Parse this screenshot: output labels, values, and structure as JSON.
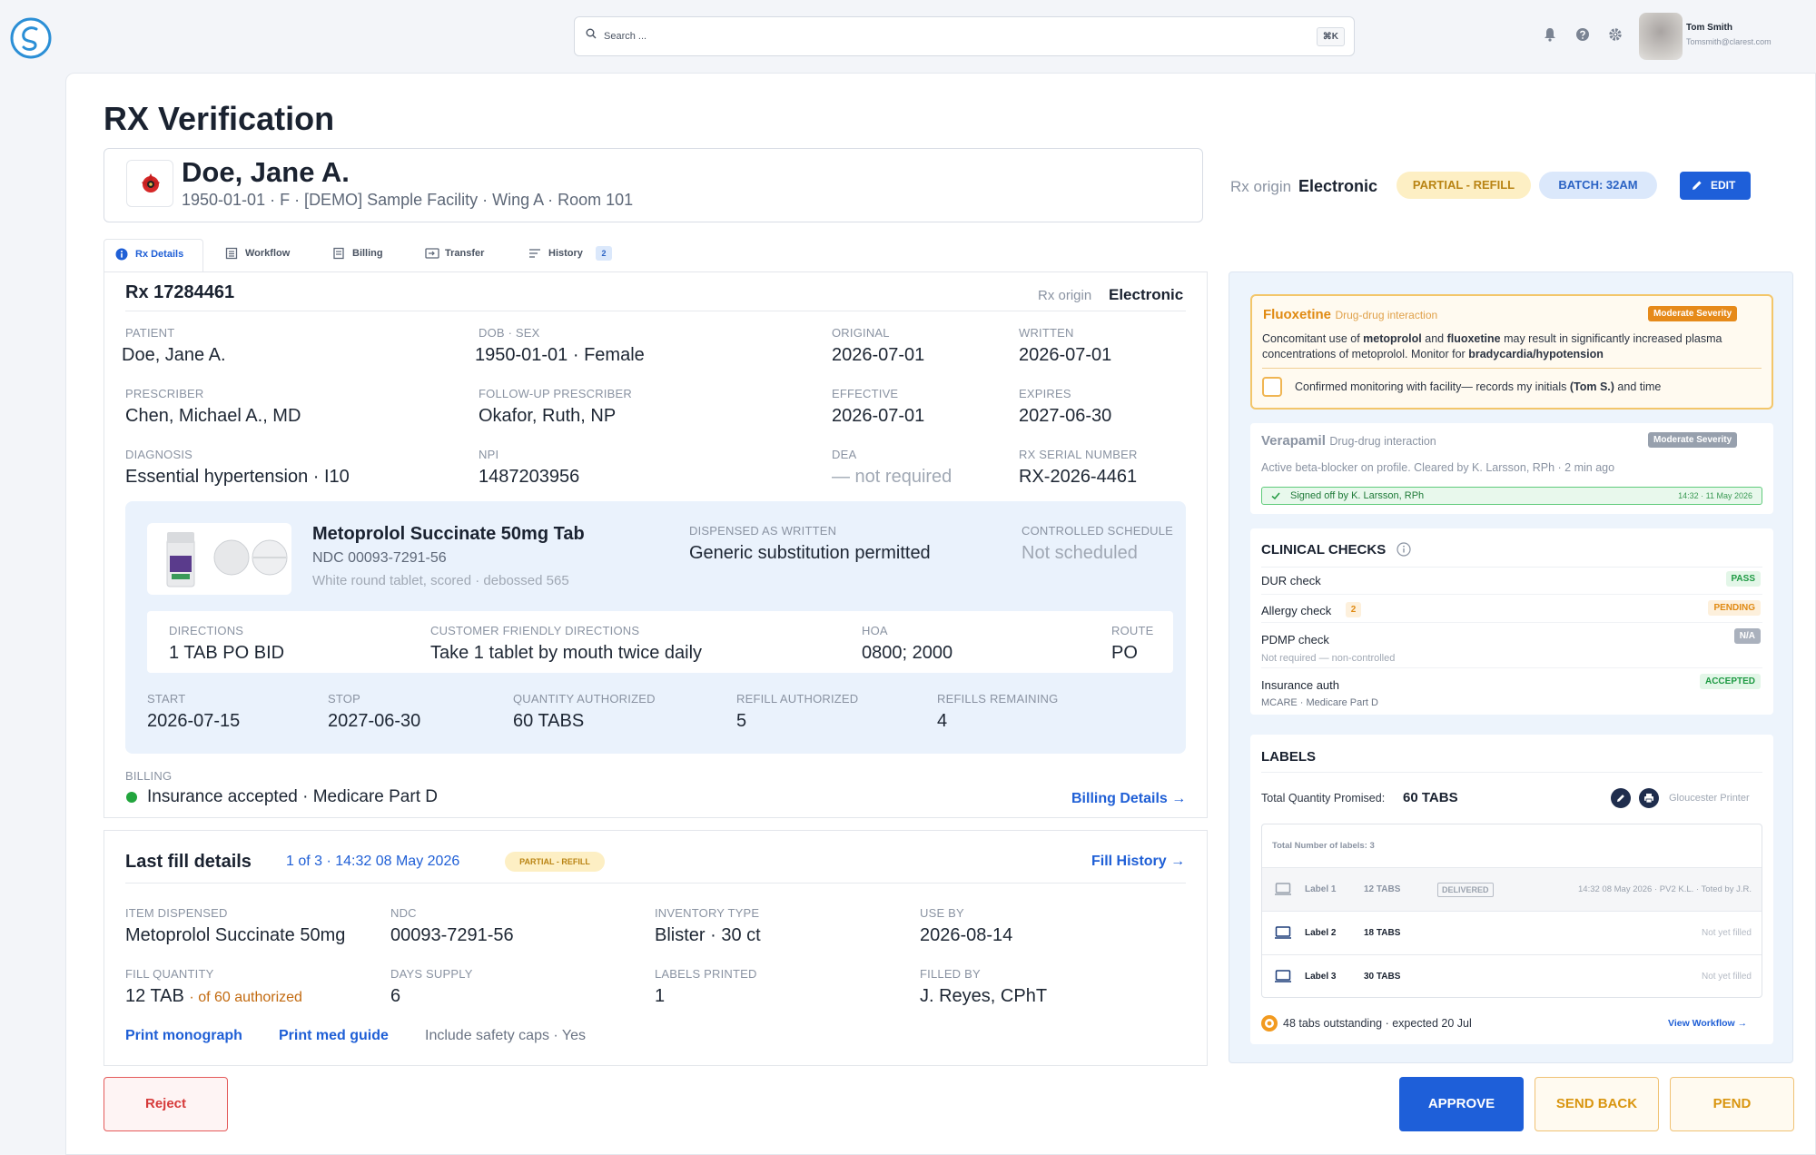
{
  "topbar": {
    "search_placeholder": "Search ...",
    "search_shortcut": "⌘K",
    "user_name": "Tom Smith",
    "user_email": "Tomsmith@clarest.com"
  },
  "page_title": "RX Verification",
  "patient": {
    "name": "Doe, Jane A.",
    "info": "1950-01-01 · F · [DEMO] Sample Facility · Wing A · Room 101",
    "rx_origin_label": "Rx origin",
    "rx_origin_value": "Electronic",
    "status_pill": "PARTIAL - REFILL",
    "batch_pill": "BATCH: 32AM",
    "edit_label": "EDIT"
  },
  "tabs": [
    {
      "label": "Rx Details",
      "icon": "info-icon"
    },
    {
      "label": "Workflow",
      "icon": "workflow-icon"
    },
    {
      "label": "Billing",
      "icon": "billing-icon"
    },
    {
      "label": "Transfer",
      "icon": "transfer-icon"
    },
    {
      "label": "History",
      "icon": "history-icon",
      "badge": "2"
    }
  ],
  "rx": {
    "number": "Rx 17284461",
    "origin_label": "Rx origin",
    "origin_value": "Electronic",
    "fields": [
      {
        "label": "PATIENT",
        "value": "Doe, Jane A."
      },
      {
        "label": "DOB · SEX",
        "value": "1950-01-01 · Female"
      },
      {
        "label": "ORIGINAL",
        "value": "2026-07-01"
      },
      {
        "label": "WRITTEN",
        "value": "2026-07-01"
      },
      {
        "label": "PRESCRIBER",
        "value": "Chen, Michael A., MD"
      },
      {
        "label": "FOLLOW-UP PRESCRIBER",
        "value": "Okafor, Ruth, NP"
      },
      {
        "label": "EFFECTIVE",
        "value": "2026-07-01"
      },
      {
        "label": "EXPIRES",
        "value": "2027-06-30"
      },
      {
        "label": "DIAGNOSIS",
        "value": "Essential hypertension · I10"
      },
      {
        "label": "NPI",
        "value": "1487203956"
      },
      {
        "label": "DEA",
        "value": "— not required"
      },
      {
        "label": "RX SERIAL NUMBER",
        "value": "RX-2026-4461"
      }
    ],
    "drug": {
      "name": "Metoprolol Succinate 50mg Tab",
      "ndc": "NDC 00093-7291-56",
      "description": "White round tablet, scored · debossed 565",
      "daw_label": "DISPENSED AS WRITTEN",
      "daw_value": "Generic substitution permitted",
      "schedule_label": "CONTROLLED SCHEDULE",
      "schedule_value": "Not scheduled"
    },
    "directions": [
      {
        "label": "DIRECTIONS",
        "value": "1 TAB PO BID"
      },
      {
        "label": "CUSTOMER FRIENDLY DIRECTIONS",
        "value": "Take 1 tablet by mouth twice daily"
      },
      {
        "label": "HOA",
        "value": "0800; 2000"
      },
      {
        "label": "ROUTE",
        "value": "PO"
      }
    ],
    "quantities": [
      {
        "label": "START",
        "value": "2026-07-15"
      },
      {
        "label": "STOP",
        "value": "2027-06-30"
      },
      {
        "label": "QUANTITY AUTHORIZED",
        "value": "60 TABS"
      },
      {
        "label": "REFILL AUTHORIZED",
        "value": "5"
      },
      {
        "label": "REFILLS REMAINING",
        "value": "4"
      }
    ],
    "billing_label": "BILLING",
    "billing_value": "Insurance accepted · Medicare Part D",
    "billing_link": "Billing Details →"
  },
  "last_fill": {
    "title": "Last fill details",
    "meta": "1 of 3 · 14:32  08 May 2026",
    "pill": "PARTIAL - REFILL",
    "history_link": "Fill History →",
    "fields": [
      {
        "label": "ITEM DISPENSED",
        "value": "Metoprolol Succinate 50mg"
      },
      {
        "label": "NDC",
        "value": "00093-7291-56"
      },
      {
        "label": "INVENTORY TYPE",
        "value": "Blister · 30 ct"
      },
      {
        "label": "USE BY",
        "value": "2026-08-14"
      },
      {
        "label": "FILL QUANTITY",
        "value": "12 TAB",
        "note": "· of 60 authorized"
      },
      {
        "label": "DAYS SUPPLY",
        "value": "6"
      },
      {
        "label": "LABELS PRINTED",
        "value": "1"
      },
      {
        "label": "FILLED BY",
        "value": "J. Reyes, CPhT"
      }
    ],
    "print_monograph": "Print monograph",
    "print_med_guide": "Print med guide",
    "safety_caps": "Include safety caps · Yes"
  },
  "alerts": [
    {
      "drug": "Fluoxetine",
      "type": "Drug-drug interaction",
      "severity": "Moderate Severity",
      "body_pre": "Concomitant use of ",
      "body_b1": "metoprolol",
      "body_mid": " and ",
      "body_b2": "fluoxetine",
      "body_post": " may result in significantly increased plasma concentrations of metoprolol. Monitor for ",
      "body_b3": "bradycardia/hypotension",
      "confirm_pre": "Confirmed monitoring with facility— records my initials ",
      "confirm_b": "(Tom S.)",
      "confirm_post": " and time"
    },
    {
      "drug": "Verapamil",
      "type": "Drug-drug interaction",
      "severity": "Moderate Severity",
      "body": "Active beta-blocker on profile. Cleared by K. Larsson, RPh · 2 min ago",
      "signed": "Signed off by K. Larsson, RPh",
      "signed_time": "14:32 · 11 May 2026"
    }
  ],
  "clinical_checks": {
    "title": "CLINICAL CHECKS",
    "items": [
      {
        "name": "DUR check",
        "status": "PASS",
        "color": "#1e9a43",
        "bg": "#e3f6e8"
      },
      {
        "name": "Allergy check",
        "count": "2",
        "status": "PENDING",
        "color": "#e08a12",
        "bg": "#fdf0dc"
      },
      {
        "name": "PDMP check",
        "sub": "Not required — non-controlled",
        "status": "N/A",
        "color": "#ffffff",
        "bg": "#aab1bd"
      },
      {
        "name": "Insurance auth",
        "sub": "MCARE · Medicare Part D",
        "status": "ACCEPTED",
        "color": "#1e9a43",
        "bg": "#e3f6e8"
      }
    ]
  },
  "labels": {
    "title": "LABELS",
    "total_label": "Total Quantity Promised:",
    "total_value": "60 TABS",
    "printer": "Gloucester Printer",
    "count_text": "Total Number of labels: 3",
    "rows": [
      {
        "name": "Label 1",
        "qty": "12 TABS",
        "status": "DELIVERED",
        "meta": "14:32  08 May 2026 · PV2 K.L. · Toted by J.R."
      },
      {
        "name": "Label 2",
        "qty": "18 TABS",
        "meta": "Not yet filled"
      },
      {
        "name": "Label 3",
        "qty": "30 TABS",
        "meta": "Not yet filled"
      }
    ],
    "outstanding": "48 tabs outstanding · expected 20 Jul",
    "workflow_link": "View Workflow →"
  },
  "actions": {
    "reject": "Reject",
    "approve": "APPROVE",
    "send_back": "SEND BACK",
    "pend": "PEND"
  }
}
